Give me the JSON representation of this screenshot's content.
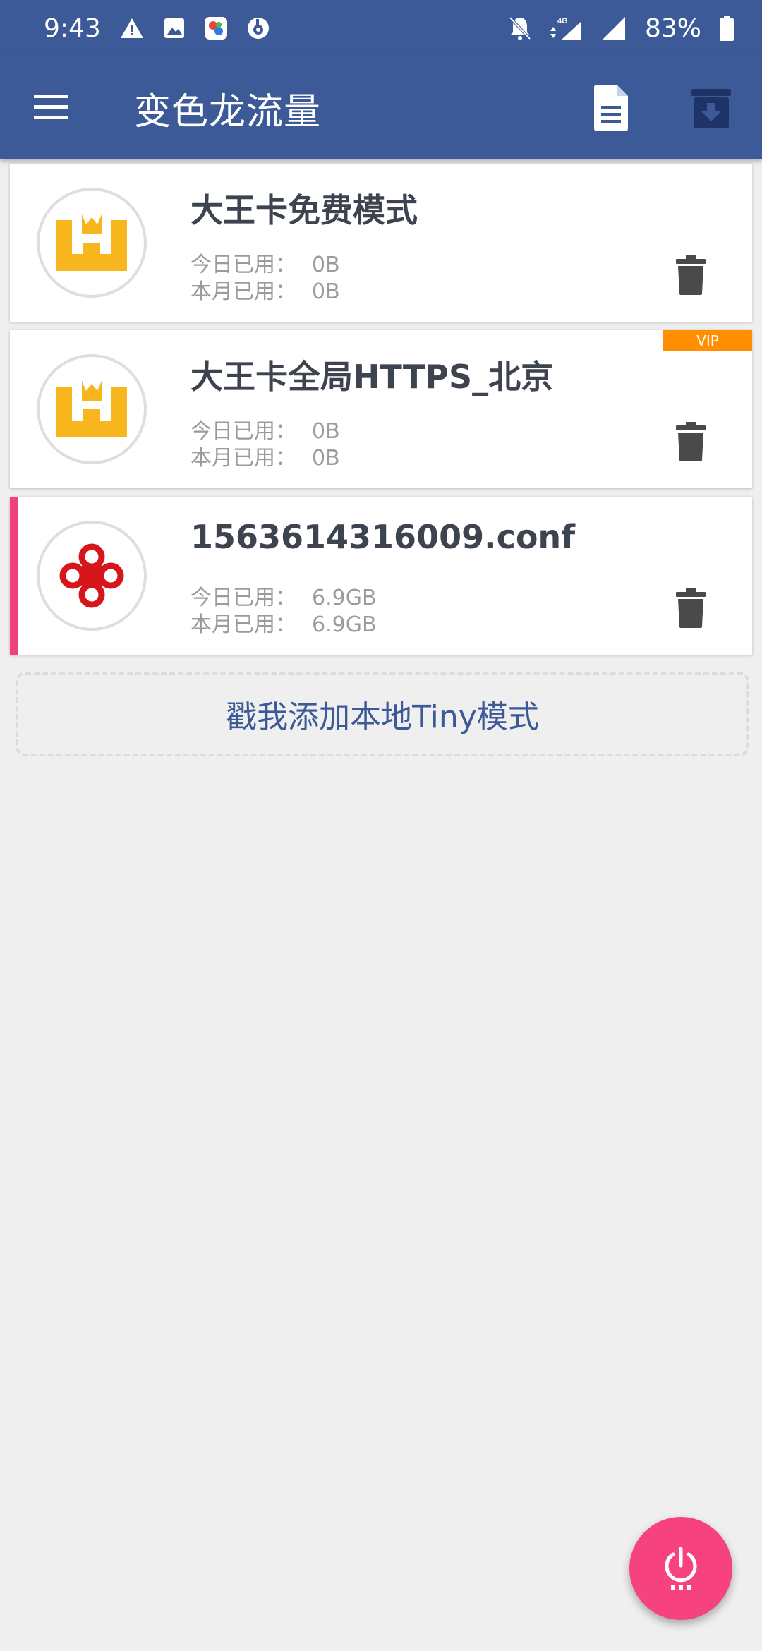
{
  "status_bar": {
    "time": "9:43",
    "battery_percent": "83%",
    "network_label": "4G",
    "icons": [
      "warning-icon",
      "image-icon",
      "app-icon",
      "bird-icon",
      "mute-bell-icon",
      "signal-icon",
      "battery-icon"
    ]
  },
  "app_bar": {
    "title": "变色龙流量",
    "icons": [
      "menu-icon",
      "document-icon",
      "archive-download-icon"
    ],
    "color": "#3c5a98"
  },
  "profiles": [
    {
      "name": "大王卡免费模式",
      "today_label": "今日已用：",
      "today_value": "0B",
      "month_label": "本月已用：",
      "month_value": "0B",
      "logo": "wangka-crown-logo",
      "vip": false,
      "active": false
    },
    {
      "name": "大王卡全局HTTPS_北京",
      "today_label": "今日已用：",
      "today_value": "0B",
      "month_label": "本月已用：",
      "month_value": "0B",
      "logo": "wangka-crown-logo",
      "vip": true,
      "vip_label": "VIP",
      "active": false
    },
    {
      "name": "1563614316009.conf",
      "today_label": "今日已用：",
      "today_value": "6.9GB",
      "month_label": "本月已用：",
      "month_value": "6.9GB",
      "logo": "china-unicom-logo",
      "vip": false,
      "active": true
    }
  ],
  "add_button": {
    "label": "戳我添加本地Tiny模式"
  },
  "fab": {
    "icon": "power-icon",
    "color": "#f6437f"
  },
  "colors": {
    "accent": "#f0417e",
    "vip": "#ff8f00",
    "logo_gold": "#f7b51e",
    "unicom_red": "#d7161c"
  }
}
